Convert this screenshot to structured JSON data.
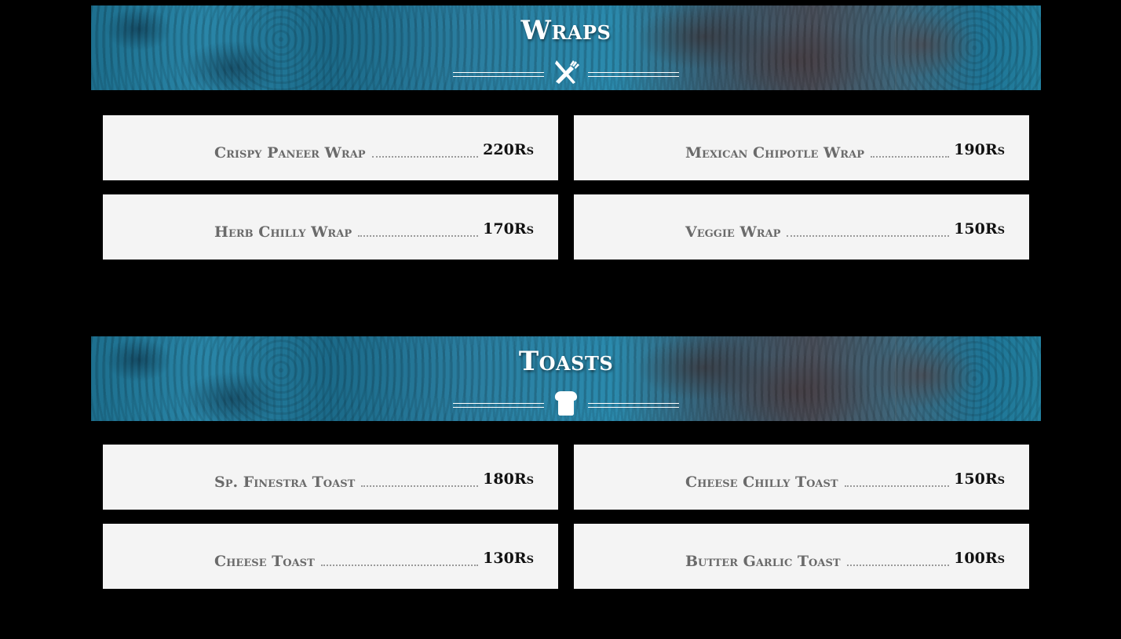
{
  "sections": [
    {
      "title": "Wraps",
      "icon": "utensils-icon",
      "items": [
        {
          "name": "Crispy Paneer Wrap",
          "price": "220Rs"
        },
        {
          "name": "Mexican Chipotle Wrap",
          "price": "190Rs"
        },
        {
          "name": "Herb Chilly Wrap",
          "price": "170Rs"
        },
        {
          "name": "Veggie Wrap",
          "price": "150Rs"
        }
      ]
    },
    {
      "title": "Toasts",
      "icon": "bread-icon",
      "items": [
        {
          "name": "Sp. Finestra Toast",
          "price": "180Rs"
        },
        {
          "name": "Cheese Chilly Toast",
          "price": "150Rs"
        },
        {
          "name": "Cheese Toast",
          "price": "130Rs"
        },
        {
          "name": "Butter Garlic Toast",
          "price": "100Rs"
        }
      ]
    }
  ],
  "colors": {
    "background": "#000000",
    "card": "#f4f4f4",
    "item_name": "#6a6a6a",
    "price": "#111111",
    "banner_accent": "#2a86a8"
  }
}
